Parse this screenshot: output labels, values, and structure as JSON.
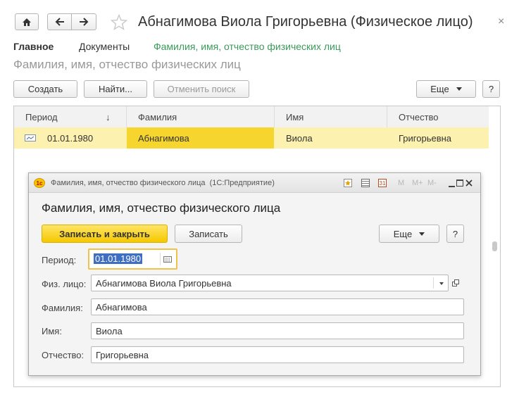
{
  "header": {
    "title": "Абнагимова Виола Григорьевна (Физическое лицо)",
    "home_icon": "home-icon",
    "back_icon": "arrow-left-icon",
    "forward_icon": "arrow-right-icon",
    "favorite_icon": "star-icon",
    "close_glyph": "×"
  },
  "tabs": {
    "main": "Главное",
    "documents": "Документы",
    "fio": "Фамилия, имя, отчество физических лиц"
  },
  "section_title": "Фамилия, имя, отчество физических лиц",
  "toolbar": {
    "create": "Создать",
    "find": "Найти...",
    "cancel_search": "Отменить поиск",
    "more": "Еще",
    "help": "?"
  },
  "table": {
    "columns": [
      "Период",
      "Фамилия",
      "Имя",
      "Отчество"
    ],
    "sort_indicator": "↓",
    "rows": [
      {
        "period": "01.01.1980",
        "surname": "Абнагимова",
        "name": "Виола",
        "patronymic": "Григорьевна"
      }
    ]
  },
  "dialog": {
    "window_title": "Фамилия, имя, отчество физического лица  (1С:Предприятие)",
    "logo": "1c",
    "form_title": "Фамилия, имя, отчество физического лица",
    "save_close": "Записать и закрыть",
    "save": "Записать",
    "more": "Еще",
    "help": "?",
    "period_label": "Период:",
    "period_value": "01.01.1980",
    "person_label": "Физ. лицо:",
    "person_value": "Абнагимова Виола Григорьевна",
    "surname_label": "Фамилия:",
    "surname_value": "Абнагимова",
    "name_label": "Имя:",
    "name_value": "Виола",
    "patronymic_label": "Отчество:",
    "patronymic_value": "Григорьевна",
    "titlebar_icons": [
      "M",
      "M+",
      "M-"
    ]
  },
  "colors": {
    "accent_green": "#3a9a5a",
    "row_highlight": "#fdf1b0",
    "cell_highlight": "#f7d52f",
    "focus_border": "#f0c14b"
  }
}
